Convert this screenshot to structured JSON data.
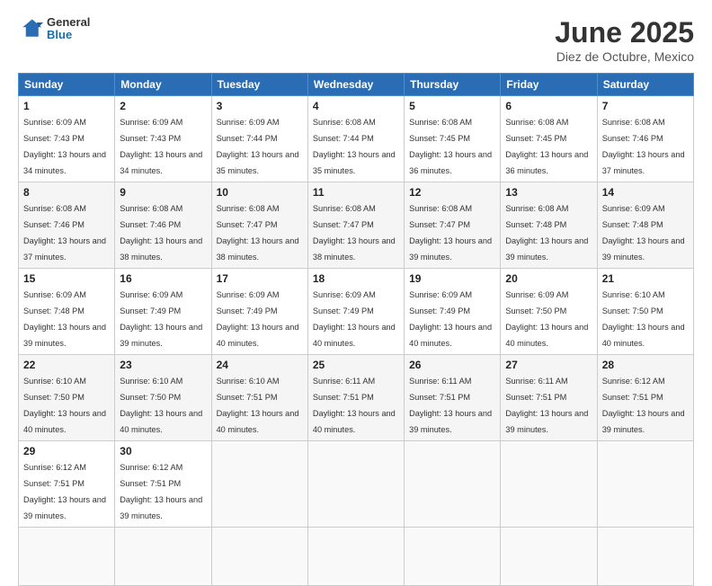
{
  "header": {
    "logo": {
      "general": "General",
      "blue": "Blue"
    },
    "title": "June 2025",
    "subtitle": "Diez de Octubre, Mexico"
  },
  "calendar": {
    "weekdays": [
      "Sunday",
      "Monday",
      "Tuesday",
      "Wednesday",
      "Thursday",
      "Friday",
      "Saturday"
    ],
    "weeks": [
      [
        null,
        null,
        null,
        null,
        null,
        null,
        null
      ]
    ],
    "days": [
      {
        "date": 1,
        "col": 0,
        "sunrise": "6:09 AM",
        "sunset": "7:43 PM",
        "daylight": "13 hours and 34 minutes."
      },
      {
        "date": 2,
        "col": 1,
        "sunrise": "6:09 AM",
        "sunset": "7:43 PM",
        "daylight": "13 hours and 34 minutes."
      },
      {
        "date": 3,
        "col": 2,
        "sunrise": "6:09 AM",
        "sunset": "7:44 PM",
        "daylight": "13 hours and 35 minutes."
      },
      {
        "date": 4,
        "col": 3,
        "sunrise": "6:08 AM",
        "sunset": "7:44 PM",
        "daylight": "13 hours and 35 minutes."
      },
      {
        "date": 5,
        "col": 4,
        "sunrise": "6:08 AM",
        "sunset": "7:45 PM",
        "daylight": "13 hours and 36 minutes."
      },
      {
        "date": 6,
        "col": 5,
        "sunrise": "6:08 AM",
        "sunset": "7:45 PM",
        "daylight": "13 hours and 36 minutes."
      },
      {
        "date": 7,
        "col": 6,
        "sunrise": "6:08 AM",
        "sunset": "7:46 PM",
        "daylight": "13 hours and 37 minutes."
      },
      {
        "date": 8,
        "col": 0,
        "sunrise": "6:08 AM",
        "sunset": "7:46 PM",
        "daylight": "13 hours and 37 minutes."
      },
      {
        "date": 9,
        "col": 1,
        "sunrise": "6:08 AM",
        "sunset": "7:46 PM",
        "daylight": "13 hours and 38 minutes."
      },
      {
        "date": 10,
        "col": 2,
        "sunrise": "6:08 AM",
        "sunset": "7:47 PM",
        "daylight": "13 hours and 38 minutes."
      },
      {
        "date": 11,
        "col": 3,
        "sunrise": "6:08 AM",
        "sunset": "7:47 PM",
        "daylight": "13 hours and 38 minutes."
      },
      {
        "date": 12,
        "col": 4,
        "sunrise": "6:08 AM",
        "sunset": "7:47 PM",
        "daylight": "13 hours and 39 minutes."
      },
      {
        "date": 13,
        "col": 5,
        "sunrise": "6:08 AM",
        "sunset": "7:48 PM",
        "daylight": "13 hours and 39 minutes."
      },
      {
        "date": 14,
        "col": 6,
        "sunrise": "6:09 AM",
        "sunset": "7:48 PM",
        "daylight": "13 hours and 39 minutes."
      },
      {
        "date": 15,
        "col": 0,
        "sunrise": "6:09 AM",
        "sunset": "7:48 PM",
        "daylight": "13 hours and 39 minutes."
      },
      {
        "date": 16,
        "col": 1,
        "sunrise": "6:09 AM",
        "sunset": "7:49 PM",
        "daylight": "13 hours and 39 minutes."
      },
      {
        "date": 17,
        "col": 2,
        "sunrise": "6:09 AM",
        "sunset": "7:49 PM",
        "daylight": "13 hours and 40 minutes."
      },
      {
        "date": 18,
        "col": 3,
        "sunrise": "6:09 AM",
        "sunset": "7:49 PM",
        "daylight": "13 hours and 40 minutes."
      },
      {
        "date": 19,
        "col": 4,
        "sunrise": "6:09 AM",
        "sunset": "7:49 PM",
        "daylight": "13 hours and 40 minutes."
      },
      {
        "date": 20,
        "col": 5,
        "sunrise": "6:09 AM",
        "sunset": "7:50 PM",
        "daylight": "13 hours and 40 minutes."
      },
      {
        "date": 21,
        "col": 6,
        "sunrise": "6:10 AM",
        "sunset": "7:50 PM",
        "daylight": "13 hours and 40 minutes."
      },
      {
        "date": 22,
        "col": 0,
        "sunrise": "6:10 AM",
        "sunset": "7:50 PM",
        "daylight": "13 hours and 40 minutes."
      },
      {
        "date": 23,
        "col": 1,
        "sunrise": "6:10 AM",
        "sunset": "7:50 PM",
        "daylight": "13 hours and 40 minutes."
      },
      {
        "date": 24,
        "col": 2,
        "sunrise": "6:10 AM",
        "sunset": "7:51 PM",
        "daylight": "13 hours and 40 minutes."
      },
      {
        "date": 25,
        "col": 3,
        "sunrise": "6:11 AM",
        "sunset": "7:51 PM",
        "daylight": "13 hours and 40 minutes."
      },
      {
        "date": 26,
        "col": 4,
        "sunrise": "6:11 AM",
        "sunset": "7:51 PM",
        "daylight": "13 hours and 39 minutes."
      },
      {
        "date": 27,
        "col": 5,
        "sunrise": "6:11 AM",
        "sunset": "7:51 PM",
        "daylight": "13 hours and 39 minutes."
      },
      {
        "date": 28,
        "col": 6,
        "sunrise": "6:12 AM",
        "sunset": "7:51 PM",
        "daylight": "13 hours and 39 minutes."
      },
      {
        "date": 29,
        "col": 0,
        "sunrise": "6:12 AM",
        "sunset": "7:51 PM",
        "daylight": "13 hours and 39 minutes."
      },
      {
        "date": 30,
        "col": 1,
        "sunrise": "6:12 AM",
        "sunset": "7:51 PM",
        "daylight": "13 hours and 39 minutes."
      }
    ]
  }
}
